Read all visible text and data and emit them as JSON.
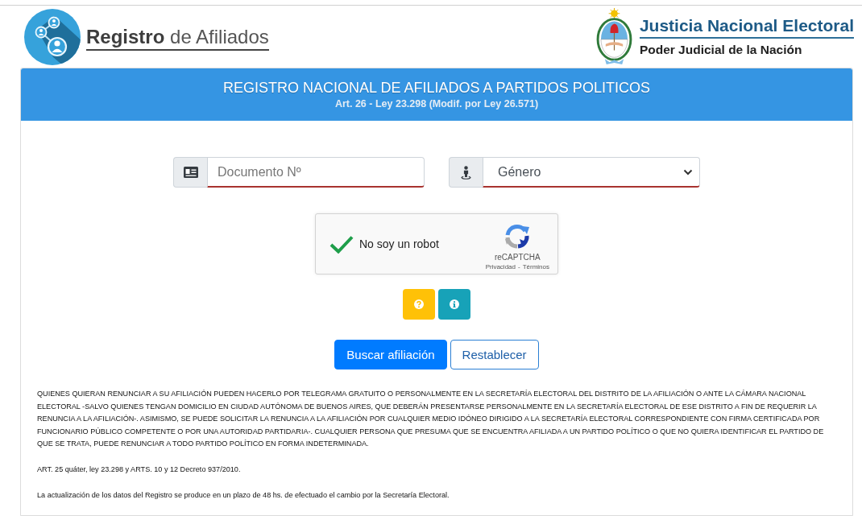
{
  "header": {
    "logo_text": "**Registro** de Afiliados",
    "institution_title": "Justicia Nacional Electoral",
    "institution_subtitle": "Poder Judicial de la Nación"
  },
  "panel": {
    "title": "REGISTRO NACIONAL DE AFILIADOS A PARTIDOS POLITICOS",
    "subtitle": "Art. 26 - Ley 23.298 (Modif. por Ley 26.571)"
  },
  "form": {
    "fields": [
      {
        "kind": "input",
        "placeholder": "Documento Nº",
        "invalid": true
      },
      {
        "kind": "select",
        "value": "Género",
        "invalid": true
      }
    ]
  },
  "captcha": {
    "checked": true,
    "label": "No soy un robot",
    "brand": "reCAPTCHA",
    "links": [
      "Privacidad",
      "Términos"
    ],
    "separator": "-"
  },
  "icon_buttons": [
    {
      "kind": "help"
    },
    {
      "kind": "info"
    }
  ],
  "buttons": [
    {
      "label": "Buscar afiliación",
      "kind": "primary"
    },
    {
      "label": "Restablecer",
      "kind": "outline"
    }
  ],
  "notes": [
    "QUIENES QUIERAN RENUNCIAR A SU AFILIACIÓN PUEDEN HACERLO POR TELEGRAMA GRATUITO O PERSONALMENTE EN LA SECRETARÍA ELECTORAL DEL DISTRITO DE LA AFILIACIÓN O ANTE LA CÁMARA NACIONAL ELECTORAL -SALVO QUIENES TENGAN DOMICILIO EN CIUDAD AUTÓNOMA DE BUENOS AIRES, QUE DEBERÁN PRESENTARSE PERSONALMENTE EN LA SECRETARÍA ELECTORAL DE ESE DISTRITO A FIN DE REQUERIR LA RENUNCIA A LA AFILIACIÓN-. ASIMISMO, SE PUEDE SOLICITAR LA RENUNCIA A LA AFILIACIÓN POR CUALQUIER MEDIO IDÓNEO DIRIGIDO A LA SECRETARÍA ELECTORAL CORRESPONDIENTE CON FIRMA CERTIFICADA POR FUNCIONARIO PÚBLICO COMPETENTE O POR UNA AUTORIDAD PARTIDARIA-. CUALQUIER PERSONA QUE PRESUMA QUE SE ENCUENTRA AFILIADA A UN PARTIDO POLÍTICO O QUE NO QUIERA IDENTIFICAR EL PARTIDO DE QUE SE TRATA, PUEDE RENUNCIAR A TODO PARTIDO POLÍTICO EN FORMA INDETERMINADA.",
    "ART. 25 quáter, ley 23.298 y ARTS. 10 y 12 Decreto 937/2010.",
    "La actualización de los datos del Registro se produce en un plazo de 48 hs. de efectuado el cambio por la Secretaría Electoral."
  ]
}
